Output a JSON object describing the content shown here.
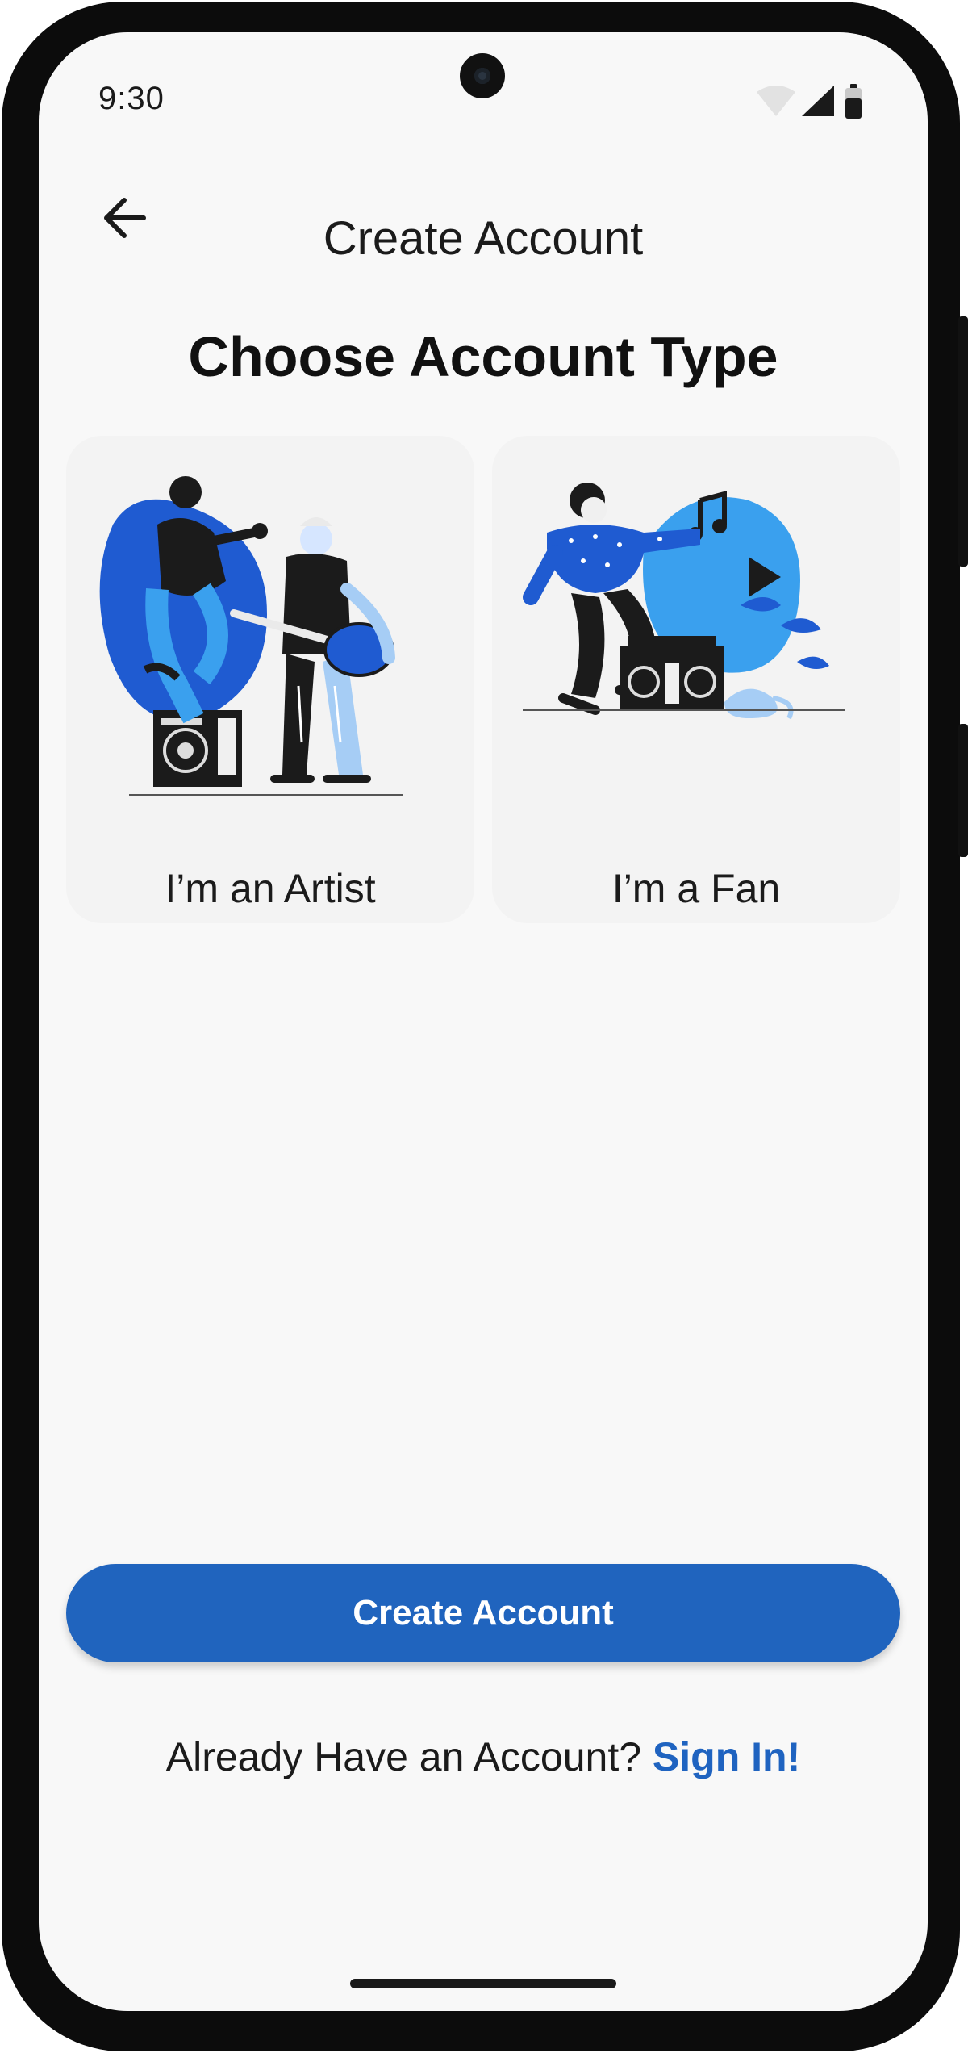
{
  "status_bar": {
    "time": "9:30",
    "icons": [
      "wifi-icon",
      "cellular-signal-icon",
      "battery-icon"
    ]
  },
  "top_bar": {
    "back_icon": "arrow-left-icon",
    "title": "Create Account"
  },
  "heading": "Choose Account Type",
  "account_types": [
    {
      "label": "I’m an Artist",
      "illustration": "artist-illustration"
    },
    {
      "label": "I’m a Fan",
      "illustration": "fan-illustration"
    }
  ],
  "primary_button": {
    "label": "Create Account"
  },
  "footer": {
    "prompt": "Already Have an Account? ",
    "link": "Sign In!"
  },
  "colors": {
    "accent": "#2064be",
    "link": "#1f63c0",
    "illustration_blue": "#1f5bd1",
    "illustration_light_blue": "#3aa0ee",
    "background": "#f8f8f8"
  }
}
